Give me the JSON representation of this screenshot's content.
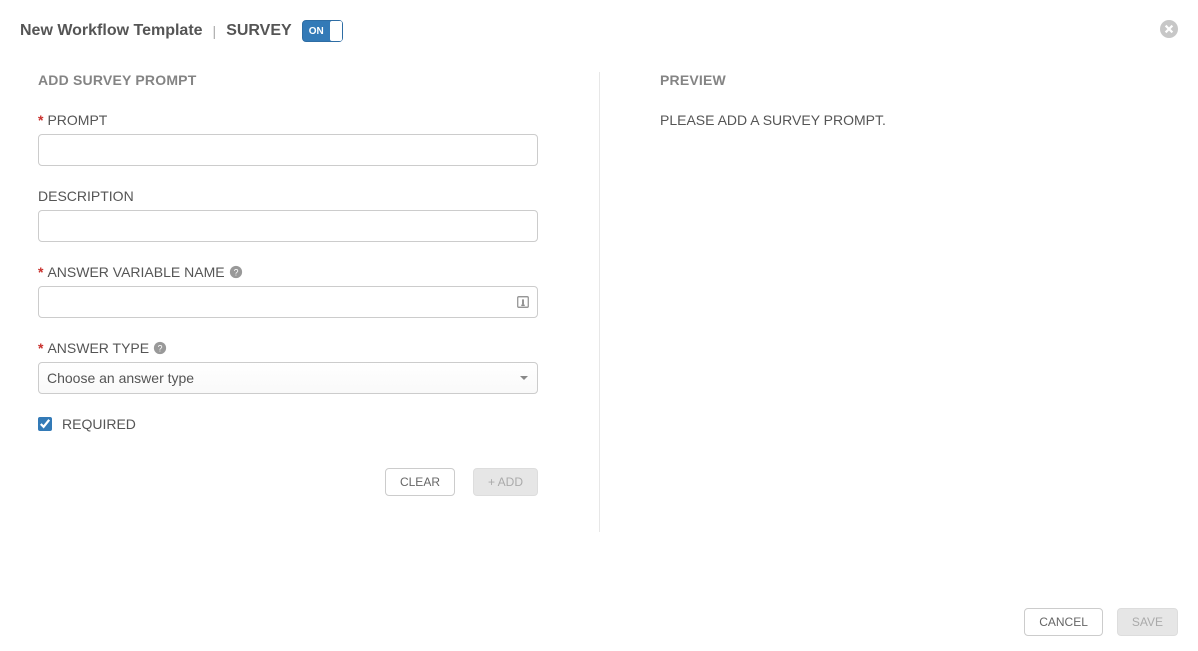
{
  "header": {
    "title": "New Workflow Template",
    "separator": "|",
    "sub": "SURVEY",
    "toggle_label": "ON"
  },
  "left": {
    "section_title": "ADD SURVEY PROMPT",
    "prompt_label": "PROMPT",
    "prompt_value": "",
    "description_label": "DESCRIPTION",
    "description_value": "",
    "answer_var_label": "ANSWER VARIABLE NAME",
    "answer_var_value": "",
    "answer_type_label": "ANSWER TYPE",
    "answer_type_placeholder": "Choose an answer type",
    "required_label": "REQUIRED",
    "clear_label": "CLEAR",
    "add_label": "+ ADD"
  },
  "right": {
    "section_title": "PREVIEW",
    "empty_msg": "PLEASE ADD A SURVEY PROMPT."
  },
  "footer": {
    "cancel_label": "CANCEL",
    "save_label": "SAVE"
  }
}
